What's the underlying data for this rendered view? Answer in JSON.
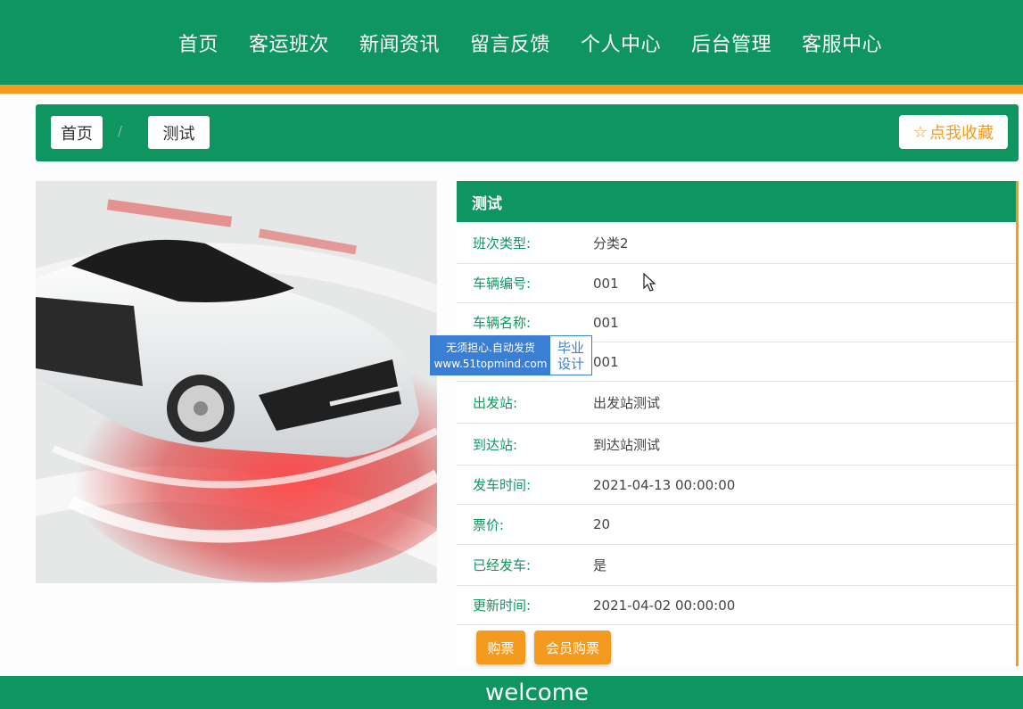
{
  "nav": {
    "items": [
      {
        "label": "首页"
      },
      {
        "label": "客运班次"
      },
      {
        "label": "新闻资讯"
      },
      {
        "label": "留言反馈"
      },
      {
        "label": "个人中心"
      },
      {
        "label": "后台管理"
      },
      {
        "label": "客服中心"
      }
    ]
  },
  "breadcrumb": {
    "home": "首页",
    "separator": "/",
    "current": "测试"
  },
  "favorite": {
    "icon": "star-outline-icon",
    "label": "点我收藏"
  },
  "detail": {
    "title": "测试",
    "rows": [
      {
        "label": "班次类型:",
        "value": "分类2"
      },
      {
        "label": "车辆编号:",
        "value": "001"
      },
      {
        "label": "车辆名称:",
        "value": "001"
      },
      {
        "label": "",
        "value": "001"
      },
      {
        "label": "出发站:",
        "value": "出发站测试"
      },
      {
        "label": "到达站:",
        "value": "到达站测试"
      },
      {
        "label": "发车时间:",
        "value": "2021-04-13 00:00:00"
      },
      {
        "label": "票价:",
        "value": "20"
      },
      {
        "label": "已经发车:",
        "value": "是"
      },
      {
        "label": "更新时间:",
        "value": "2021-04-02 00:00:00"
      }
    ],
    "buttons": {
      "buy": "购票",
      "member_buy": "会员购票"
    }
  },
  "watermark": {
    "line1": "无须担心.自动发货",
    "line2": "www.51topmind.com",
    "side1": "毕业",
    "side2": "设计"
  },
  "footer": {
    "text": "welcome"
  },
  "colors": {
    "primary": "#0f9660",
    "accent": "#f39a1f"
  }
}
